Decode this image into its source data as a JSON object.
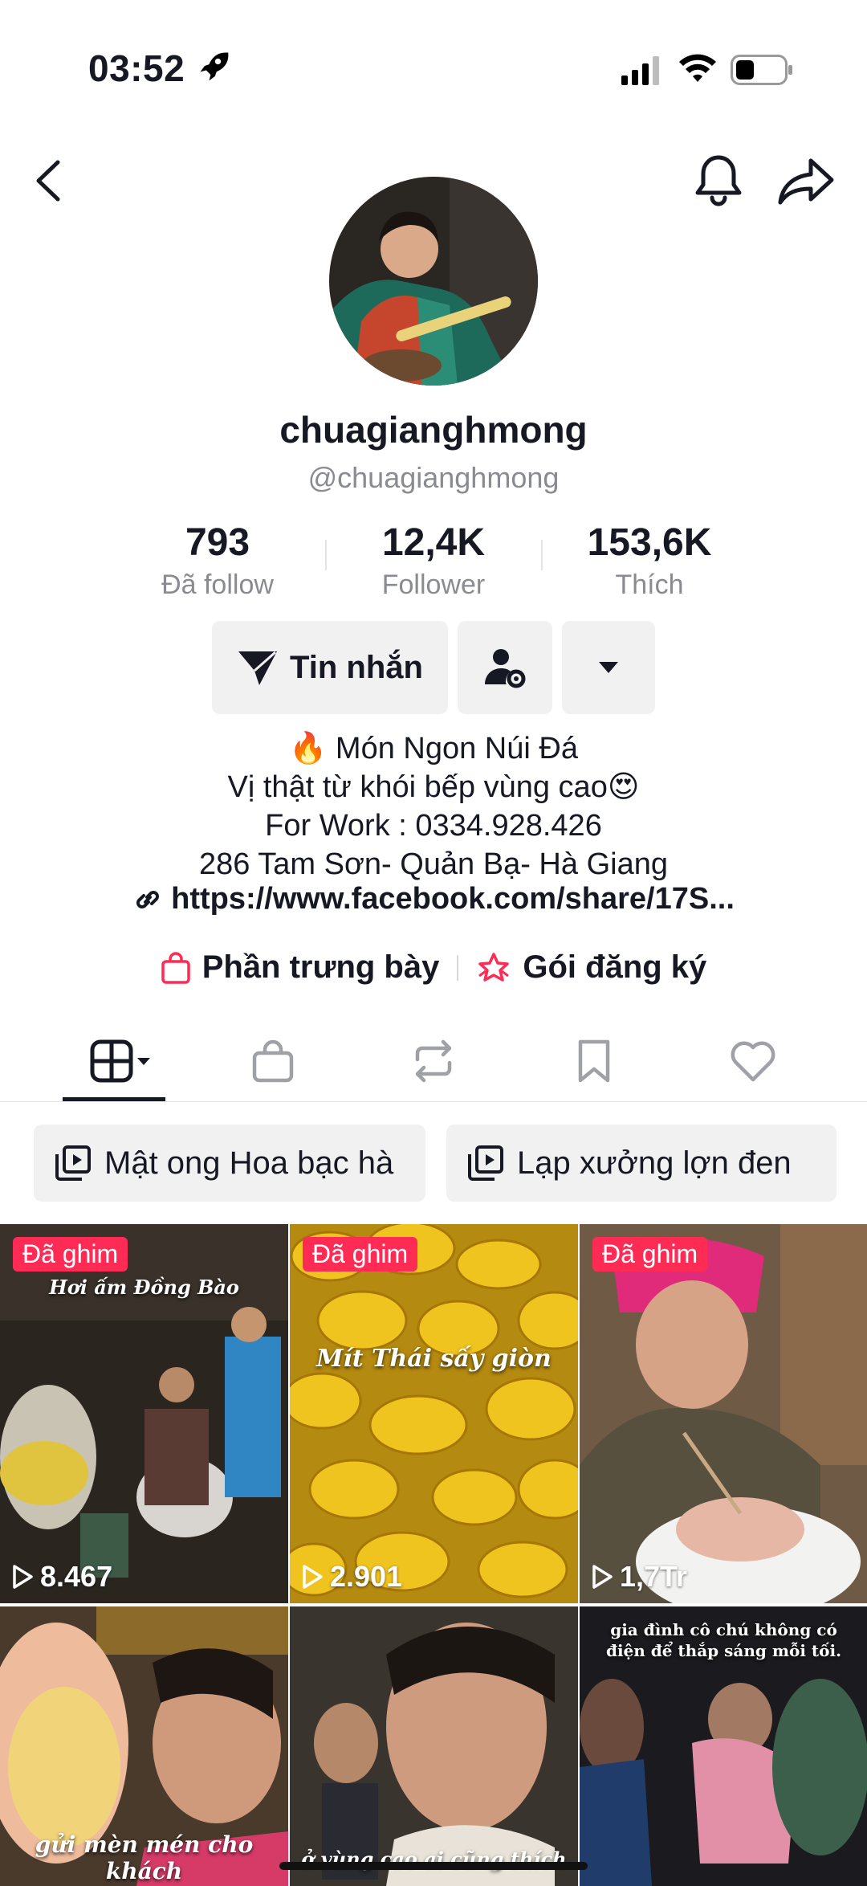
{
  "status_bar": {
    "time": "03:52"
  },
  "profile": {
    "username": "chuagianghmong",
    "handle": "@chuagianghmong",
    "stats": [
      {
        "value": "793",
        "label": "Đã follow"
      },
      {
        "value": "12,4K",
        "label": "Follower"
      },
      {
        "value": "153,6K",
        "label": "Thích"
      }
    ],
    "message_button": "Tin nhắn",
    "bio": [
      "🔥 Món Ngon Núi Đá",
      "Vị thật từ khói bếp vùng cao😍",
      "For Work : 0334.928.426",
      "286 Tam Sơn- Quản Bạ- Hà Giang"
    ],
    "link": "https://www.facebook.com/share/17S...",
    "showcase_label": "Phần trưng bày",
    "subscription_label": "Gói đăng ký"
  },
  "playlists": [
    {
      "label": "Mật ong Hoa bạc hà"
    },
    {
      "label": "Lạp xưởng lợn đen"
    }
  ],
  "videos": [
    {
      "pinned": "Đã ghim",
      "views": "8.467",
      "caption": "Hơi ấm Đồng Bào"
    },
    {
      "pinned": "Đã ghim",
      "views": "2.901",
      "caption": "Mít Thái sấy giòn"
    },
    {
      "pinned": "Đã ghim",
      "views": "1,7Tr",
      "caption": ""
    },
    {
      "pinned": "",
      "views": "",
      "caption": "gửi mèn mén cho khách"
    },
    {
      "pinned": "",
      "views": "",
      "caption": "ở vùng cao ai cũng thích"
    },
    {
      "pinned": "",
      "views": "",
      "caption": "gia đình cô chú không có điện để thắp sáng mỗi tối."
    }
  ],
  "colors": {
    "accent": "#fe2c55",
    "text": "#161823",
    "muted": "#8a8b91",
    "button_bg": "#f1f1f2"
  }
}
